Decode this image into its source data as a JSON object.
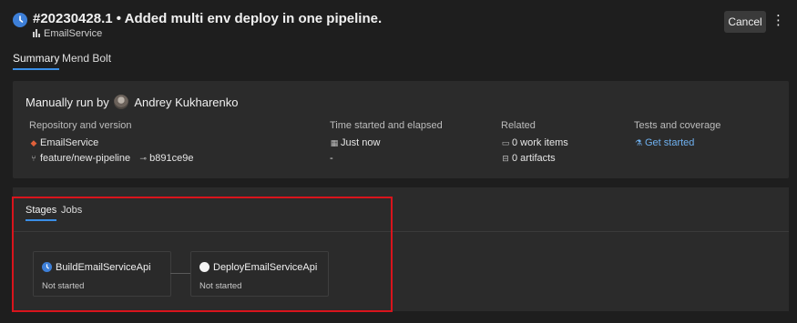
{
  "header": {
    "title": "#20230428.1 • Added multi env deploy in one pipeline.",
    "repo_label": "EmailService",
    "cancel_label": "Cancel",
    "more_label": "⋮"
  },
  "tabs": [
    {
      "label": "Summary",
      "active": true
    },
    {
      "label": "Mend Bolt",
      "active": false
    }
  ],
  "summary": {
    "run_by_prefix": "Manually run by",
    "run_by_user": "Andrey Kukharenko",
    "repository": {
      "heading": "Repository and version",
      "repo": "EmailService",
      "branch": "feature/new-pipeline",
      "commit": "b891ce9e"
    },
    "time": {
      "heading": "Time started and elapsed",
      "started": "Just now",
      "elapsed": "-"
    },
    "related": {
      "heading": "Related",
      "work_items": "0 work items",
      "artifacts": "0 artifacts"
    },
    "tests": {
      "heading": "Tests and coverage",
      "link": "Get started"
    }
  },
  "stages_panel": {
    "tabs": [
      {
        "label": "Stages",
        "active": true
      },
      {
        "label": "Jobs",
        "active": false
      }
    ],
    "stages": [
      {
        "name": "BuildEmailServiceApi",
        "status": "Not started",
        "state": "running"
      },
      {
        "name": "DeployEmailServiceApi",
        "status": "Not started",
        "state": "pending"
      }
    ]
  },
  "colors": {
    "accent": "#3a8ee6",
    "highlight": "#d9141c",
    "link": "#6fb1f0"
  }
}
